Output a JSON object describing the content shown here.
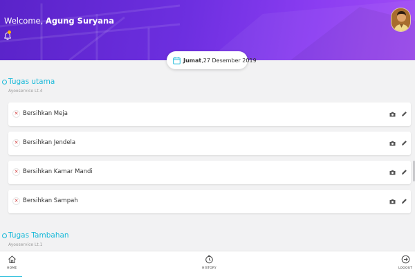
{
  "header": {
    "welcome_prefix": "Welcome,",
    "user_name": "Agung Suryana",
    "accent_color": "#6d2fe0",
    "bell_icon": "bell-icon",
    "avatar": "user-avatar"
  },
  "date": {
    "day": "Jumat",
    "rest": " ,27 Desember 2019",
    "icon": "calendar-icon"
  },
  "sections": [
    {
      "title": "Tugas utama",
      "subtitle": "Ayooservice Lt.4",
      "tasks": [
        {
          "label": "Bersihkan Meja"
        },
        {
          "label": "Bersihkan Jendela"
        },
        {
          "label": "Bersihkan Kamar Mandi"
        },
        {
          "label": "Bersihkan Sampah"
        }
      ]
    },
    {
      "title": "Tugas Tambahan",
      "subtitle": "Ayooservice Lt.1",
      "tasks": []
    }
  ],
  "task_icons": {
    "status": "close-icon",
    "photo": "camera-icon",
    "edit": "pencil-icon"
  },
  "bottom_nav": [
    {
      "label": "HOME",
      "icon": "home-icon",
      "active": true
    },
    {
      "label": "HISTORY",
      "icon": "history-icon",
      "active": false
    },
    {
      "label": "LOGOUT",
      "icon": "logout-icon",
      "active": false
    }
  ]
}
